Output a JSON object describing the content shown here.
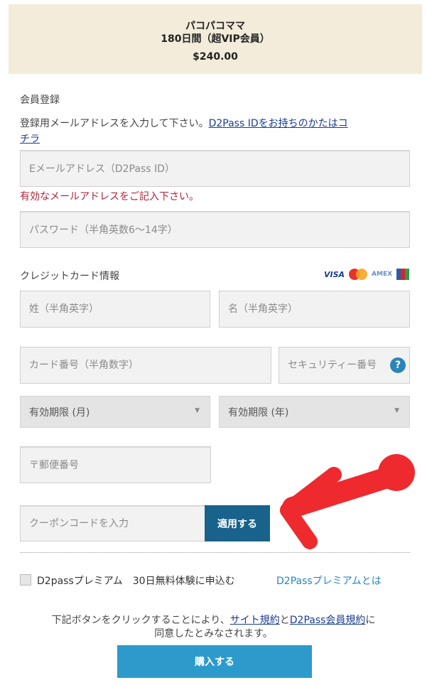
{
  "header": {
    "product": "パコパコママ",
    "plan": "180日間（超VIP会員）",
    "price": "$240.00"
  },
  "registration": {
    "title": "会員登録",
    "instruction": "登録用メールアドレスを入力して下さい。",
    "d2pass_link_1": "D2Pass IDをお持ちのかたはコ",
    "d2pass_link_2": "チラ",
    "email_placeholder": "Eメールアドレス（D2Pass ID）",
    "email_error": "有効なメールアドレスをご記入下さい。",
    "password_placeholder": "パスワード（半角英数6～14字）"
  },
  "credit_card": {
    "title": "クレジットカード情報",
    "brands": {
      "visa": "VISA",
      "amex": "AMEX"
    },
    "last_name_placeholder": "姓（半角英字）",
    "first_name_placeholder": "名（半角英字）",
    "card_number_placeholder": "カード番号（半角数字）",
    "security_code_placeholder": "セキュリティー番号",
    "help_symbol": "?",
    "expiry_month": "有効期限 (月)",
    "expiry_year": "有効期限 (年)",
    "postal_placeholder": "〒郵便番号"
  },
  "coupon": {
    "placeholder": "クーポンコードを入力",
    "apply_label": "適用する"
  },
  "premium": {
    "label": "D2passプレミアム　30日無料体験に申込む",
    "link": "D2Passプレミアムとは"
  },
  "agreement": {
    "prefix": "下記ボタンをクリックすることにより、",
    "terms_link": "サイト規約",
    "and": "と",
    "member_terms_link": "D2Pass会員規約",
    "suffix": "に",
    "line2": "同意したとみなされます。"
  },
  "purchase": {
    "label": "購入する"
  },
  "colors": {
    "header_bg": "#f3ecda",
    "apply_button": "#19628b",
    "buy_button": "#2c9bcb",
    "error_text": "#b0243c",
    "link": "#1a3d8f",
    "annotation_arrow": "#ee2a2f"
  },
  "icons": {
    "help": "question-circle-icon",
    "dropdown": "chevron-down-icon",
    "annotation": "red-arrow-icon"
  }
}
